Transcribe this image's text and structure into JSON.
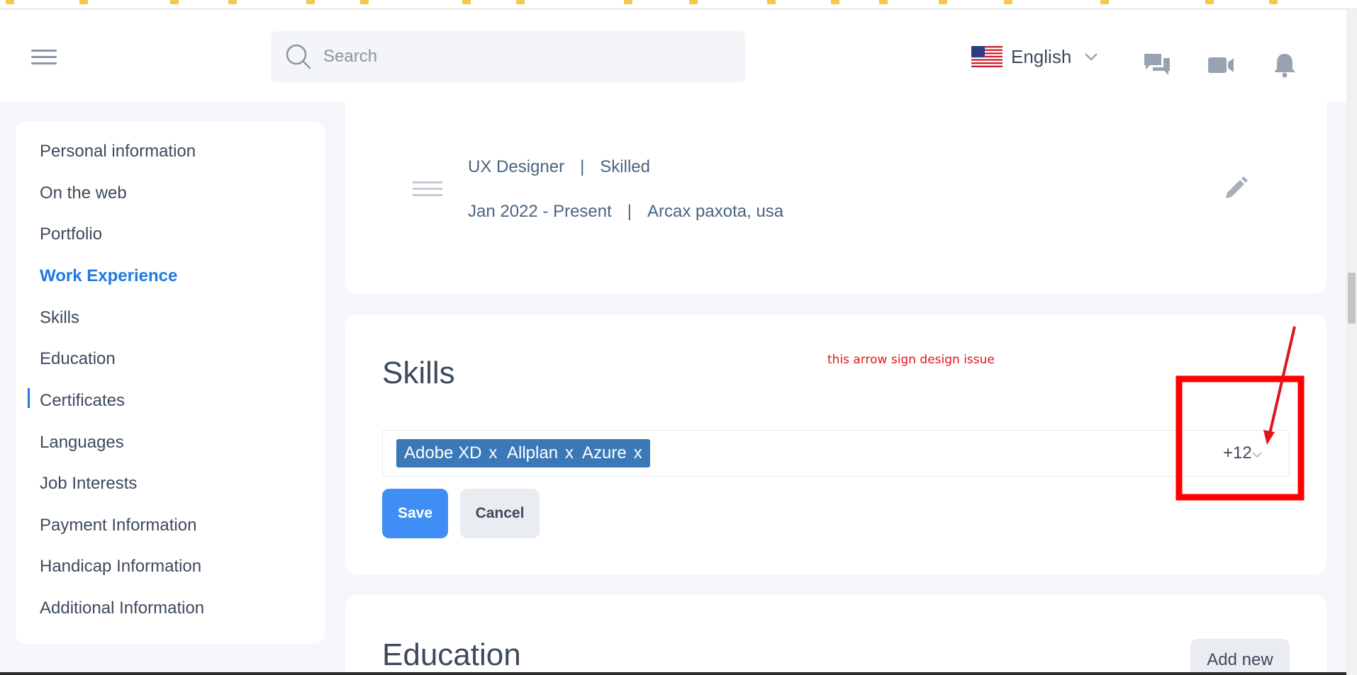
{
  "header": {
    "search_placeholder": "Search",
    "language": "English"
  },
  "sidebar": {
    "items": [
      {
        "label": "Personal information"
      },
      {
        "label": "On the web"
      },
      {
        "label": "Portfolio"
      },
      {
        "label": "Work Experience",
        "active": true
      },
      {
        "label": "Skills"
      },
      {
        "label": "Education"
      },
      {
        "label": "Certificates"
      },
      {
        "label": "Languages"
      },
      {
        "label": "Job Interests"
      },
      {
        "label": "Payment Information"
      },
      {
        "label": "Handicap Information"
      },
      {
        "label": "Additional Information"
      }
    ]
  },
  "experience": {
    "title": "UX Designer",
    "level": "Skilled",
    "period": "Jan 2022 - Present",
    "location": "Arcax paxota, usa",
    "separator": "|"
  },
  "skills": {
    "title": "Skills",
    "chips": [
      {
        "label": "Adobe XD",
        "remove": "x"
      },
      {
        "label": "Allplan",
        "remove": "x"
      },
      {
        "label": "Azure",
        "remove": "x"
      }
    ],
    "more_count": "+12",
    "save_label": "Save",
    "cancel_label": "Cancel"
  },
  "annotation": {
    "text": "this arrow sign design issue",
    "color": "#e0151b"
  },
  "education": {
    "title": "Education",
    "add_label": "Add new"
  },
  "colors": {
    "accent": "#1f7ae0",
    "chip": "#3a78b7",
    "save": "#3f8ef5",
    "background": "#f4f6fb"
  },
  "icons": [
    "menu-icon",
    "search-icon",
    "us-flag-icon",
    "chevron-down-icon",
    "chat-icon",
    "video-icon",
    "bell-icon",
    "drag-handle-icon",
    "pencil-icon"
  ]
}
